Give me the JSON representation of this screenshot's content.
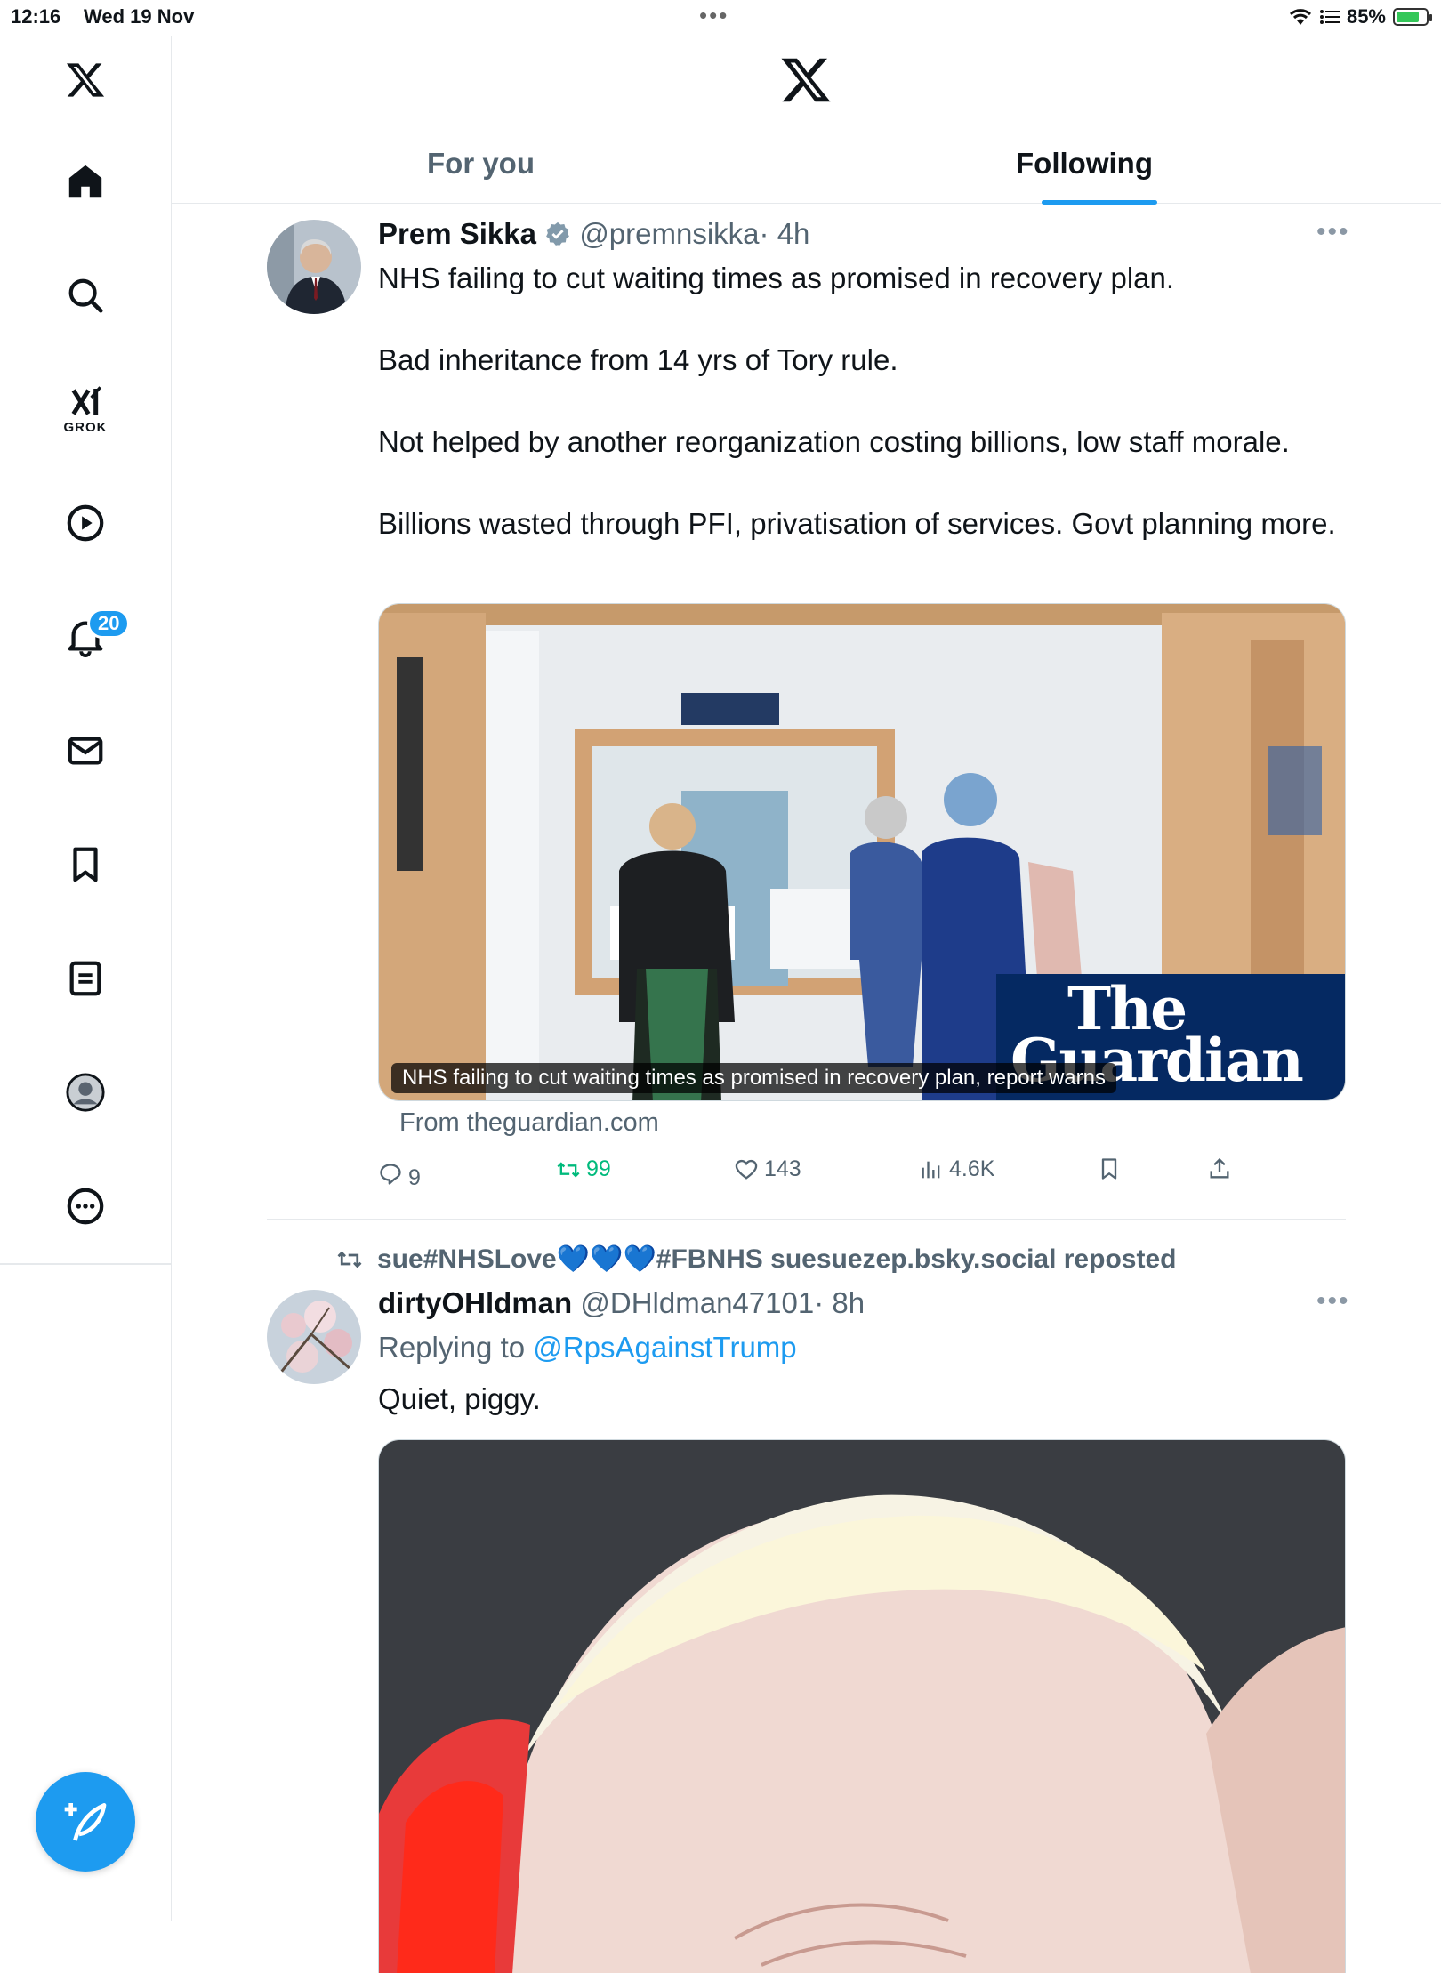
{
  "status_bar": {
    "time": "12:16",
    "date": "Wed 19 Nov",
    "battery": "85%"
  },
  "tabs": [
    {
      "label": "For you"
    },
    {
      "label": "Following"
    }
  ],
  "sidebar": {
    "items": [
      "x-logo",
      "home",
      "search",
      "grok",
      "video",
      "notifications",
      "messages",
      "bookmarks",
      "lists",
      "profile",
      "more"
    ],
    "grok_label": "GROK",
    "notifications_badge": "20"
  },
  "tweet1": {
    "name": "Prem Sikka",
    "handle": "@premnsikka",
    "time": "· 4h",
    "paragraphs": [
      "NHS failing to cut waiting times as promised in recovery plan.",
      "Bad inheritance from 14 yrs of Tory rule.",
      "Not helped by another reorganization costing billions, low staff morale.",
      "Billions wasted through PFI, privatisation of services. Govt planning more."
    ],
    "card_caption": "NHS failing to cut waiting times as promised in recovery plan, report warns",
    "card_brand_line1": "The",
    "card_brand_line2": "Guardian",
    "from": "From theguardian.com",
    "replies": "9",
    "reposts": "99",
    "likes": "143",
    "views": "4.6K"
  },
  "tweet2": {
    "repost_by": "sue#NHSLove💙💙💙#FBNHS suesuezep.bsky.social reposted",
    "name": "dirtyOHldman",
    "handle": "@DHldman47101",
    "time": "· 8h",
    "replying_prefix": "Replying to",
    "replying_to": "@RpsAgainstTrump",
    "text": "Quiet, piggy."
  },
  "colors": {
    "accent": "#1d9bf0",
    "repost_green": "#00ba7c",
    "guardian_blue": "#052962"
  }
}
